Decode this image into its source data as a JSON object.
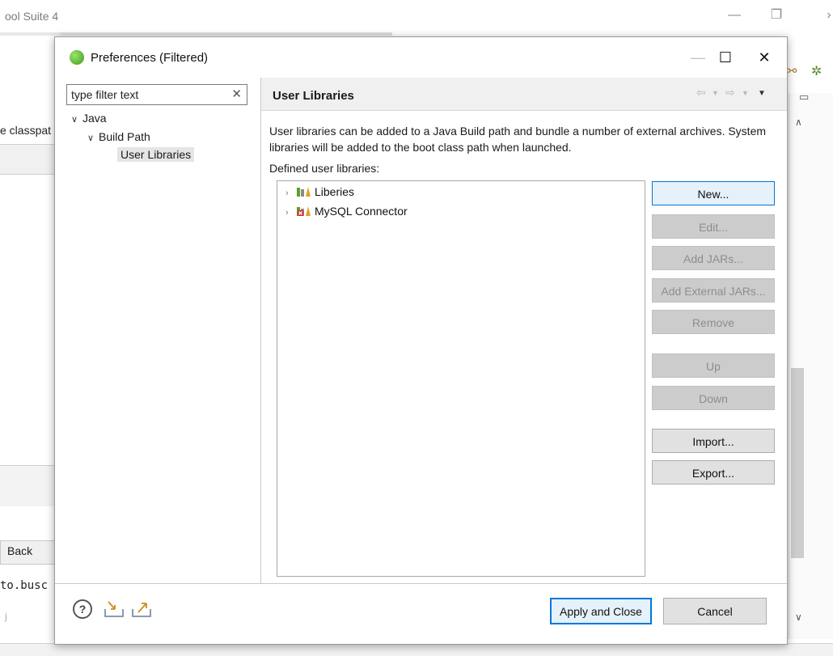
{
  "background": {
    "window_title": "ool Suite 4",
    "left_text": "e classpat",
    "back_label": "Back",
    "mono_text": "to.busc",
    "mono_text2": "j"
  },
  "dialog": {
    "title": "Preferences (Filtered)",
    "filter": {
      "placeholder": "type filter text",
      "value": ""
    },
    "tree": [
      {
        "label": "Java",
        "expanded": true,
        "level": 0
      },
      {
        "label": "Build Path",
        "expanded": true,
        "level": 1
      },
      {
        "label": "User Libraries",
        "selected": true,
        "level": 2
      }
    ],
    "page_title": "User Libraries",
    "description": "User libraries can be added to a Java Build path and bundle a number of external archives. System libraries will be added to the boot class path when launched.",
    "defined_label": "Defined user libraries:",
    "libraries": [
      {
        "name": "Liberies",
        "icon": "library-icon"
      },
      {
        "name": "MySQL Connector",
        "icon": "library-error-icon"
      }
    ],
    "buttons": {
      "new": "New...",
      "edit": "Edit...",
      "add_jars": "Add JARs...",
      "add_external_jars": "Add External JARs...",
      "remove": "Remove",
      "up": "Up",
      "down": "Down",
      "import": "Import...",
      "export": "Export..."
    },
    "footer": {
      "apply_close": "Apply and Close",
      "cancel": "Cancel"
    }
  },
  "colors": {
    "accent": "#0078d7",
    "disabled_button": "#cccccc",
    "header_bg": "#f0f0f0"
  }
}
